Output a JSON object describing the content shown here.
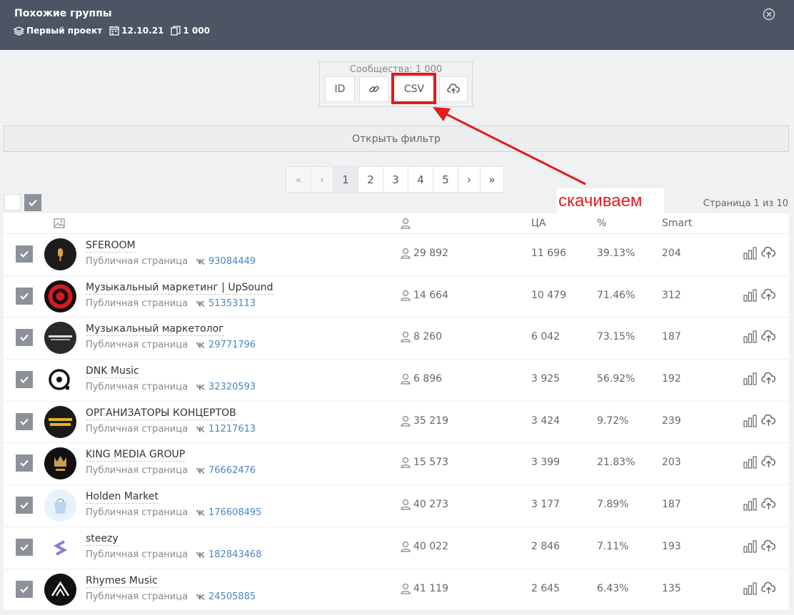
{
  "header": {
    "title": "Похожие группы",
    "project": "Первый проект",
    "date": "12.10.21",
    "count": "1 000"
  },
  "toolbox": {
    "communities_label": "Сообщества: 1 000",
    "buttons": [
      "ID",
      "link-icon",
      "CSV",
      "cloud-upload-icon"
    ]
  },
  "filter_label": "Открыть фильтр",
  "pagination": [
    "«",
    "‹",
    "1",
    "2",
    "3",
    "4",
    "5",
    "›",
    "»"
  ],
  "annotation": "скачиваем",
  "page_info": "Страница 1 из 10",
  "columns": {
    "ca": "ЦА",
    "percent": "%",
    "smart": "Smart"
  },
  "rows": [
    {
      "name": "SFEROOM",
      "type": "Публичная страница",
      "vk_id": "93084449",
      "members": "29 892",
      "ca": "11 696",
      "percent": "39.13%",
      "smart": "204"
    },
    {
      "name": "Музыкальный маркетинг | UpSound",
      "type": "Публичная страница",
      "vk_id": "51353113",
      "members": "14 664",
      "ca": "10 479",
      "percent": "71.46%",
      "smart": "312"
    },
    {
      "name": "Музыкальный маркетолог",
      "type": "Публичная страница",
      "vk_id": "29771796",
      "members": "8 260",
      "ca": "6 042",
      "percent": "73.15%",
      "smart": "187"
    },
    {
      "name": "DNK Music",
      "type": "Публичная страница",
      "vk_id": "32320593",
      "members": "6 896",
      "ca": "3 925",
      "percent": "56.92%",
      "smart": "192"
    },
    {
      "name": "ОРГАНИЗАТОРЫ КОНЦЕРТОВ",
      "type": "Публичная страница",
      "vk_id": "11217613",
      "members": "35 219",
      "ca": "3 424",
      "percent": "9.72%",
      "smart": "239"
    },
    {
      "name": "KING MEDIA GROUP",
      "type": "Публичная страница",
      "vk_id": "76662476",
      "members": "15 573",
      "ca": "3 399",
      "percent": "21.83%",
      "smart": "203"
    },
    {
      "name": "Holden Market",
      "type": "Публичная страница",
      "vk_id": "176608495",
      "members": "40 273",
      "ca": "3 177",
      "percent": "7.89%",
      "smart": "187"
    },
    {
      "name": "steezy",
      "type": "Публичная страница",
      "vk_id": "182843468",
      "members": "40 022",
      "ca": "2 846",
      "percent": "7.11%",
      "smart": "193"
    },
    {
      "name": "Rhymes Music",
      "type": "Публичная страница",
      "vk_id": "24505885",
      "members": "41 119",
      "ca": "2 645",
      "percent": "6.43%",
      "smart": "135"
    }
  ],
  "colors": {
    "header_bg": "#4b5563",
    "accent_red": "#e31b1b",
    "link_blue": "#4a86c5",
    "checkbox_gray": "#8c9298"
  }
}
